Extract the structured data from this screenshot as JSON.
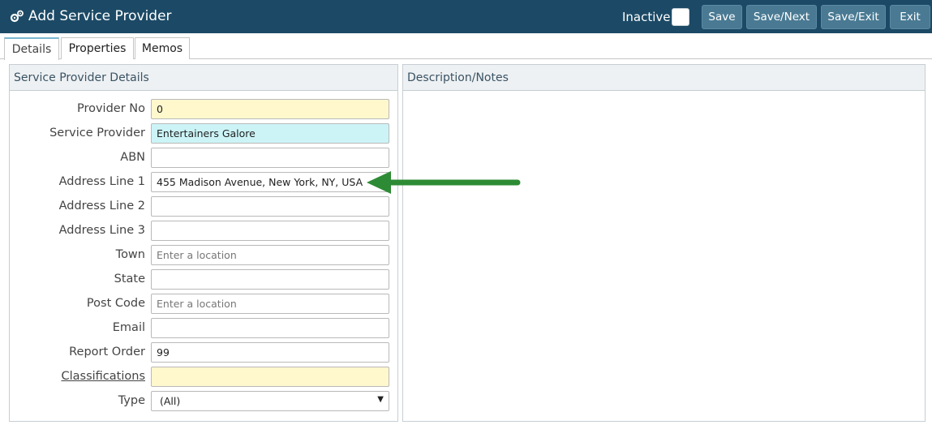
{
  "window": {
    "title": "Add Service Provider",
    "inactive_label": "Inactive",
    "inactive_checked": false
  },
  "toolbar": {
    "save": "Save",
    "save_next": "Save/Next",
    "save_exit": "Save/Exit",
    "exit": "Exit"
  },
  "tabs": [
    {
      "label": "Details",
      "active": true
    },
    {
      "label": "Properties",
      "active": false
    },
    {
      "label": "Memos",
      "active": false
    }
  ],
  "details_panel": {
    "heading": "Service Provider Details",
    "fields": [
      {
        "label": "Provider No",
        "value": "0"
      },
      {
        "label": "Service Provider",
        "value": "Entertainers Galore"
      },
      {
        "label": "ABN",
        "value": ""
      },
      {
        "label": "Address Line 1",
        "value": "455 Madison Avenue, New York, NY, USA"
      },
      {
        "label": "Address Line 2",
        "value": ""
      },
      {
        "label": "Address Line 3",
        "value": ""
      },
      {
        "label": "Town",
        "value": "",
        "placeholder": "Enter a location"
      },
      {
        "label": "State",
        "value": ""
      },
      {
        "label": "Post Code",
        "value": "",
        "placeholder": "Enter a location"
      },
      {
        "label": "Email",
        "value": ""
      },
      {
        "label": "Report Order",
        "value": "99"
      },
      {
        "label": "Classifications",
        "value": ""
      },
      {
        "label": "Type",
        "value": "(All)"
      }
    ]
  },
  "notes_panel": {
    "heading": "Description/Notes"
  },
  "colors": {
    "header_bg": "#1c4a66",
    "button_bg": "#4a7a93",
    "required_yellow": "#fff8cd",
    "highlight_cyan": "#ccf4f7",
    "annotation_arrow": "#2e8b35"
  }
}
